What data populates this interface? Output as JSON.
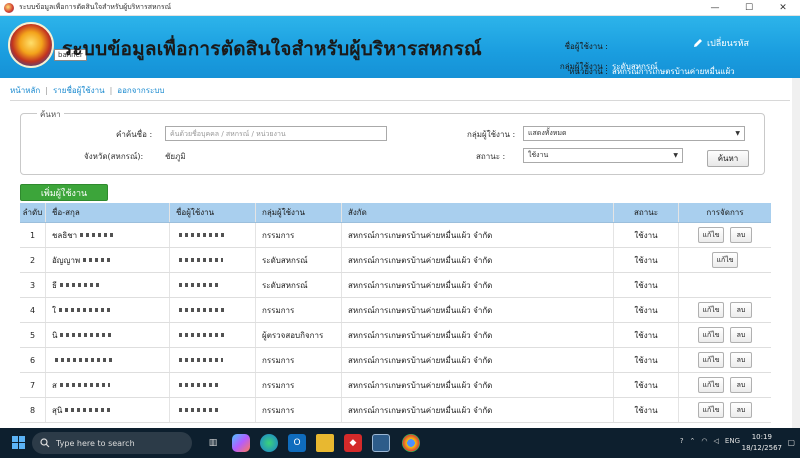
{
  "window": {
    "title": "ระบบข้อมูลเพื่อการตัดสินใจสำหรับผู้บริหารสหกรณ์",
    "min": "—",
    "max": "☐",
    "close": "✕"
  },
  "header": {
    "title": "ระบบข้อมูลเพื่อการตัดสินใจสำหรับผู้บริหารสหกรณ์",
    "tooltip": "banner",
    "change_password": "เปลี่ยนรหัส",
    "user_label": "ชื่อผู้ใช้งาน :",
    "user_value": "",
    "group_label": "กลุ่มผู้ใช้งาน :",
    "group_value": "ระดับสหกรณ์",
    "unit_label": "หน่วยงาน :",
    "unit_value": "สหกรณ์การเกษตรบ้านค่ายหมื่นแผ้ว"
  },
  "breadcrumb": {
    "home": "หน้าหลัก",
    "users": "รายชื่อผู้ใช้งาน",
    "logout": "ออกจากระบบ",
    "sep": "|"
  },
  "search": {
    "legend": "ค้นหา",
    "keyword_label": "คำค้นชื่อ :",
    "keyword_placeholder": "ค้นด้วยชื่อบุคคล / สหกรณ์ / หน่วยงาน",
    "province_label": "จังหวัด(สหกรณ์):",
    "province_value": "ชัยภูมิ",
    "group_label": "กลุ่มผู้ใช้งาน :",
    "group_value": "แสดงทั้งหมด",
    "status_label": "สถานะ :",
    "status_value": "ใช้งาน",
    "button": "ค้นหา"
  },
  "add_user_label": "เพิ่มผู้ใช้งาน",
  "table": {
    "headers": [
      "ลำดับ",
      "ชื่อ-สกุล",
      "ชื่อผู้ใช้งาน",
      "กลุ่มผู้ใช้งาน",
      "สังกัด",
      "สถานะ",
      "การจัดการ"
    ],
    "edit_label": "แก้ไข",
    "delete_label": "ลบ",
    "rows": [
      {
        "no": "1",
        "name": "ชลธิชา",
        "group": "กรรมการ",
        "aff": "สหกรณ์การเกษตรบ้านค่ายหมื่นแผ้ว จำกัด",
        "status": "ใช้งาน",
        "del": true
      },
      {
        "no": "2",
        "name": "อัญญาพ",
        "group": "ระดับสหกรณ์",
        "aff": "สหกรณ์การเกษตรบ้านค่ายหมื่นแผ้ว จำกัด",
        "status": "ใช้งาน",
        "del": false
      },
      {
        "no": "3",
        "name": "ธี",
        "group": "ระดับสหกรณ์",
        "aff": "สหกรณ์การเกษตรบ้านค่ายหมื่นแผ้ว จำกัด",
        "status": "ใช้งาน",
        "del": false,
        "noedit": true
      },
      {
        "no": "4",
        "name": "ใ",
        "group": "กรรมการ",
        "aff": "สหกรณ์การเกษตรบ้านค่ายหมื่นแผ้ว จำกัด",
        "status": "ใช้งาน",
        "del": true
      },
      {
        "no": "5",
        "name": "นิ",
        "group": "ผู้ตรวจสอบกิจการ",
        "aff": "สหกรณ์การเกษตรบ้านค่ายหมื่นแผ้ว จำกัด",
        "status": "ใช้งาน",
        "del": true
      },
      {
        "no": "6",
        "name": "",
        "group": "กรรมการ",
        "aff": "สหกรณ์การเกษตรบ้านค่ายหมื่นแผ้ว จำกัด",
        "status": "ใช้งาน",
        "del": true
      },
      {
        "no": "7",
        "name": "ส",
        "group": "กรรมการ",
        "aff": "สหกรณ์การเกษตรบ้านค่ายหมื่นแผ้ว จำกัด",
        "status": "ใช้งาน",
        "del": true
      },
      {
        "no": "8",
        "name": "สุนิ",
        "group": "กรรมการ",
        "aff": "สหกรณ์การเกษตรบ้านค่ายหมื่นแผ้ว จำกัด",
        "status": "ใช้งาน",
        "del": true
      }
    ]
  },
  "taskbar": {
    "search_placeholder": "Type here to search",
    "lang": "ENG",
    "time": "10:19",
    "date": "18/12/2567"
  }
}
